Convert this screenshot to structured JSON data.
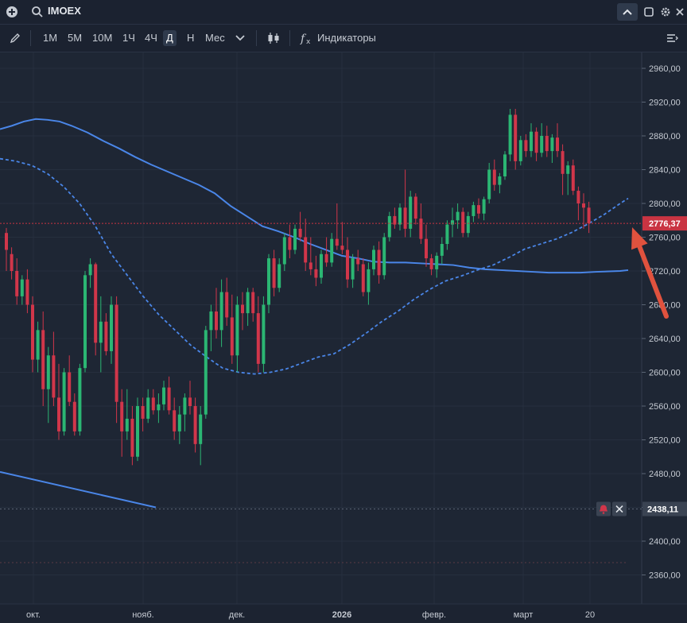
{
  "header": {
    "symbol": "IMOEX"
  },
  "toolbar": {
    "timeframes": [
      "1М",
      "5М",
      "10М",
      "1Ч",
      "4Ч",
      "Д",
      "Н",
      "Мес"
    ],
    "active_timeframe": "Д",
    "indicators_label": "Индикаторы"
  },
  "colors": {
    "background": "#1e2634",
    "bull": "#2bb673",
    "bear": "#d1364a",
    "ma": "#4a86e8",
    "trendline": "#4a86e8",
    "price_tag": "#c93442",
    "alert_tag": "#3a4352",
    "annotation_arrow": "#e0523e"
  },
  "chart_data": {
    "type": "candlestick",
    "yaxis": {
      "ticks": [
        "2960,00",
        "2920,00",
        "2880,00",
        "2840,00",
        "2800,00",
        "2760,00",
        "2720,00",
        "2680,00",
        "2640,00",
        "2600,00",
        "2560,00",
        "2520,00",
        "2480,00",
        "2440,00",
        "2400,00",
        "2360,00"
      ],
      "range": [
        2340,
        2980
      ]
    },
    "xaxis": {
      "labels": [
        "окт.",
        "нояб.",
        "дек.",
        "2026",
        "февр.",
        "март",
        "20"
      ]
    },
    "last_price_label": "2776,37",
    "last_price": 2776.37,
    "alert_level_label": "2438,11",
    "alert_level": 2438.11,
    "candles_ohlc": [
      [
        2765,
        2771,
        2720,
        2745
      ],
      [
        2740,
        2748,
        2710,
        2720
      ],
      [
        2720,
        2735,
        2680,
        2690
      ],
      [
        2690,
        2715,
        2680,
        2710
      ],
      [
        2710,
        2722,
        2670,
        2680
      ],
      [
        2680,
        2690,
        2600,
        2615
      ],
      [
        2615,
        2660,
        2600,
        2650
      ],
      [
        2650,
        2672,
        2560,
        2580
      ],
      [
        2580,
        2630,
        2540,
        2620
      ],
      [
        2620,
        2648,
        2560,
        2570
      ],
      [
        2570,
        2610,
        2520,
        2530
      ],
      [
        2530,
        2605,
        2525,
        2600
      ],
      [
        2600,
        2620,
        2560,
        2565
      ],
      [
        2565,
        2575,
        2525,
        2530
      ],
      [
        2530,
        2610,
        2525,
        2605
      ],
      [
        2605,
        2720,
        2600,
        2715
      ],
      [
        2715,
        2735,
        2700,
        2728
      ],
      [
        2728,
        2730,
        2620,
        2635
      ],
      [
        2635,
        2690,
        2600,
        2660
      ],
      [
        2660,
        2670,
        2620,
        2625
      ],
      [
        2625,
        2690,
        2610,
        2680
      ],
      [
        2680,
        2690,
        2540,
        2565
      ],
      [
        2565,
        2580,
        2500,
        2530
      ],
      [
        2530,
        2580,
        2520,
        2545
      ],
      [
        2545,
        2560,
        2490,
        2500
      ],
      [
        2500,
        2570,
        2495,
        2560
      ],
      [
        2560,
        2570,
        2530,
        2545
      ],
      [
        2545,
        2580,
        2540,
        2570
      ],
      [
        2570,
        2580,
        2550,
        2555
      ],
      [
        2555,
        2575,
        2540,
        2562
      ],
      [
        2562,
        2590,
        2555,
        2582
      ],
      [
        2582,
        2595,
        2550,
        2555
      ],
      [
        2555,
        2570,
        2520,
        2530
      ],
      [
        2530,
        2560,
        2515,
        2550
      ],
      [
        2550,
        2575,
        2530,
        2570
      ],
      [
        2570,
        2590,
        2550,
        2560
      ],
      [
        2560,
        2570,
        2505,
        2515
      ],
      [
        2515,
        2560,
        2490,
        2550
      ],
      [
        2550,
        2655,
        2545,
        2650
      ],
      [
        2650,
        2680,
        2625,
        2672
      ],
      [
        2672,
        2700,
        2640,
        2650
      ],
      [
        2650,
        2710,
        2630,
        2695
      ],
      [
        2695,
        2712,
        2655,
        2665
      ],
      [
        2665,
        2692,
        2610,
        2620
      ],
      [
        2620,
        2690,
        2600,
        2680
      ],
      [
        2680,
        2695,
        2650,
        2670
      ],
      [
        2670,
        2700,
        2655,
        2695
      ],
      [
        2695,
        2700,
        2660,
        2670
      ],
      [
        2670,
        2690,
        2600,
        2610
      ],
      [
        2610,
        2690,
        2600,
        2680
      ],
      [
        2680,
        2740,
        2670,
        2735
      ],
      [
        2735,
        2745,
        2690,
        2700
      ],
      [
        2700,
        2735,
        2695,
        2728
      ],
      [
        2728,
        2765,
        2720,
        2760
      ],
      [
        2760,
        2775,
        2735,
        2745
      ],
      [
        2745,
        2775,
        2740,
        2770
      ],
      [
        2770,
        2790,
        2755,
        2760
      ],
      [
        2760,
        2782,
        2720,
        2730
      ],
      [
        2730,
        2760,
        2715,
        2722
      ],
      [
        2722,
        2738,
        2702,
        2712
      ],
      [
        2712,
        2745,
        2705,
        2740
      ],
      [
        2740,
        2760,
        2725,
        2730
      ],
      [
        2730,
        2765,
        2725,
        2758
      ],
      [
        2758,
        2800,
        2745,
        2750
      ],
      [
        2750,
        2778,
        2740,
        2745
      ],
      [
        2745,
        2760,
        2700,
        2710
      ],
      [
        2710,
        2740,
        2700,
        2735
      ],
      [
        2735,
        2745,
        2720,
        2728
      ],
      [
        2728,
        2735,
        2690,
        2695
      ],
      [
        2695,
        2730,
        2680,
        2722
      ],
      [
        2722,
        2750,
        2715,
        2745
      ],
      [
        2745,
        2755,
        2705,
        2715
      ],
      [
        2715,
        2765,
        2710,
        2760
      ],
      [
        2760,
        2790,
        2755,
        2785
      ],
      [
        2785,
        2795,
        2770,
        2775
      ],
      [
        2775,
        2800,
        2768,
        2795
      ],
      [
        2795,
        2840,
        2760,
        2770
      ],
      [
        2770,
        2815,
        2760,
        2808
      ],
      [
        2808,
        2812,
        2775,
        2782
      ],
      [
        2782,
        2800,
        2752,
        2758
      ],
      [
        2758,
        2775,
        2725,
        2735
      ],
      [
        2735,
        2740,
        2715,
        2722
      ],
      [
        2722,
        2742,
        2712,
        2738
      ],
      [
        2738,
        2760,
        2728,
        2752
      ],
      [
        2752,
        2780,
        2745,
        2775
      ],
      [
        2775,
        2795,
        2760,
        2780
      ],
      [
        2780,
        2800,
        2770,
        2790
      ],
      [
        2790,
        2795,
        2760,
        2765
      ],
      [
        2765,
        2790,
        2760,
        2785
      ],
      [
        2785,
        2802,
        2778,
        2798
      ],
      [
        2798,
        2806,
        2782,
        2788
      ],
      [
        2788,
        2808,
        2780,
        2805
      ],
      [
        2805,
        2848,
        2800,
        2840
      ],
      [
        2840,
        2852,
        2815,
        2822
      ],
      [
        2822,
        2836,
        2812,
        2832
      ],
      [
        2832,
        2862,
        2828,
        2858
      ],
      [
        2858,
        2912,
        2850,
        2905
      ],
      [
        2905,
        2912,
        2840,
        2850
      ],
      [
        2850,
        2880,
        2845,
        2875
      ],
      [
        2875,
        2882,
        2855,
        2862
      ],
      [
        2862,
        2895,
        2855,
        2885
      ],
      [
        2885,
        2890,
        2850,
        2860
      ],
      [
        2860,
        2895,
        2855,
        2880
      ],
      [
        2880,
        2892,
        2855,
        2862
      ],
      [
        2862,
        2882,
        2848,
        2878
      ],
      [
        2878,
        2895,
        2855,
        2862
      ],
      [
        2862,
        2870,
        2810,
        2835
      ],
      [
        2835,
        2850,
        2810,
        2845
      ],
      [
        2845,
        2852,
        2810,
        2815
      ],
      [
        2815,
        2820,
        2780,
        2800
      ],
      [
        2800,
        2812,
        2770,
        2795
      ],
      [
        2795,
        2802,
        2765,
        2776.37
      ]
    ],
    "moving_averages": [
      {
        "style": "solid",
        "points": [
          [
            0,
            2888
          ],
          [
            15,
            2892
          ],
          [
            30,
            2897
          ],
          [
            45,
            2900
          ],
          [
            60,
            2899
          ],
          [
            75,
            2897
          ],
          [
            90,
            2892
          ],
          [
            110,
            2884
          ],
          [
            130,
            2874
          ],
          [
            150,
            2865
          ],
          [
            170,
            2855
          ],
          [
            190,
            2846
          ],
          [
            210,
            2838
          ],
          [
            230,
            2830
          ],
          [
            250,
            2822
          ],
          [
            270,
            2812
          ],
          [
            290,
            2797
          ],
          [
            310,
            2785
          ],
          [
            330,
            2773
          ],
          [
            350,
            2767
          ],
          [
            370,
            2760
          ],
          [
            390,
            2752
          ],
          [
            410,
            2745
          ],
          [
            430,
            2738
          ],
          [
            450,
            2735
          ],
          [
            470,
            2731
          ],
          [
            490,
            2730
          ],
          [
            510,
            2730
          ],
          [
            530,
            2729
          ],
          [
            550,
            2728
          ],
          [
            570,
            2727
          ],
          [
            590,
            2724
          ],
          [
            610,
            2722
          ],
          [
            630,
            2721
          ],
          [
            650,
            2720
          ],
          [
            670,
            2719
          ],
          [
            690,
            2718
          ],
          [
            710,
            2718
          ],
          [
            730,
            2718
          ],
          [
            750,
            2719
          ],
          [
            780,
            2720
          ],
          [
            790,
            2721
          ]
        ]
      },
      {
        "style": "dashed",
        "points": [
          [
            0,
            2853
          ],
          [
            20,
            2850
          ],
          [
            40,
            2845
          ],
          [
            60,
            2835
          ],
          [
            80,
            2820
          ],
          [
            100,
            2800
          ],
          [
            120,
            2773
          ],
          [
            140,
            2740
          ],
          [
            160,
            2715
          ],
          [
            180,
            2690
          ],
          [
            200,
            2668
          ],
          [
            220,
            2650
          ],
          [
            240,
            2632
          ],
          [
            260,
            2618
          ],
          [
            280,
            2605
          ],
          [
            300,
            2600
          ],
          [
            320,
            2598
          ],
          [
            340,
            2600
          ],
          [
            360,
            2604
          ],
          [
            380,
            2611
          ],
          [
            400,
            2618
          ],
          [
            420,
            2622
          ],
          [
            440,
            2633
          ],
          [
            460,
            2646
          ],
          [
            480,
            2660
          ],
          [
            500,
            2672
          ],
          [
            520,
            2686
          ],
          [
            540,
            2698
          ],
          [
            560,
            2708
          ],
          [
            580,
            2714
          ],
          [
            600,
            2721
          ],
          [
            620,
            2727
          ],
          [
            640,
            2736
          ],
          [
            660,
            2746
          ],
          [
            680,
            2752
          ],
          [
            700,
            2758
          ],
          [
            720,
            2766
          ],
          [
            740,
            2776
          ],
          [
            760,
            2787
          ],
          [
            780,
            2800
          ],
          [
            790,
            2806
          ]
        ]
      }
    ],
    "trendline": {
      "points": [
        [
          0,
          2482
        ],
        [
          196,
          2440
        ]
      ]
    },
    "annotations": [
      {
        "type": "arrow",
        "pointing_to": "last candle / moving average"
      }
    ]
  }
}
